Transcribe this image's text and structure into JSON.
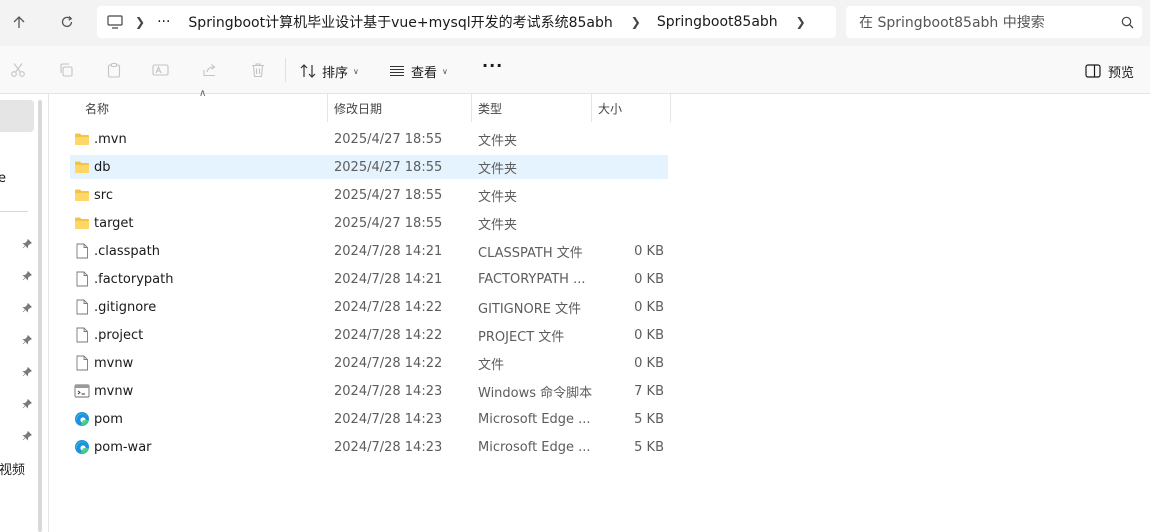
{
  "address_bar": {
    "path_ellipsis": "···",
    "crumbs": [
      "Springboot计算机毕业设计基于vue+mysql开发的考试系统85abh",
      "Springboot85abh"
    ]
  },
  "search": {
    "placeholder": "在 Springboot85abh 中搜索"
  },
  "command_bar": {
    "sort_label": "排序",
    "view_label": "查看",
    "more_label": "···",
    "preview_label": "预览"
  },
  "nav_fragments": {
    "top": "e",
    "bottom": "视频"
  },
  "columns": {
    "name": "名称",
    "date": "修改日期",
    "type": "类型",
    "size": "大小"
  },
  "files": [
    {
      "name": ".mvn",
      "date": "2025/4/27 18:55",
      "type": "文件夹",
      "size": "",
      "icon": "folder-icon"
    },
    {
      "name": "db",
      "date": "2025/4/27 18:55",
      "type": "文件夹",
      "size": "",
      "icon": "folder-icon"
    },
    {
      "name": "src",
      "date": "2025/4/27 18:55",
      "type": "文件夹",
      "size": "",
      "icon": "folder-icon"
    },
    {
      "name": "target",
      "date": "2025/4/27 18:55",
      "type": "文件夹",
      "size": "",
      "icon": "folder-icon"
    },
    {
      "name": ".classpath",
      "date": "2024/7/28 14:21",
      "type": "CLASSPATH 文件",
      "size": "0 KB",
      "icon": "file-icon"
    },
    {
      "name": ".factorypath",
      "date": "2024/7/28 14:21",
      "type": "FACTORYPATH ...",
      "size": "0 KB",
      "icon": "file-icon"
    },
    {
      "name": ".gitignore",
      "date": "2024/7/28 14:22",
      "type": "GITIGNORE 文件",
      "size": "0 KB",
      "icon": "file-icon"
    },
    {
      "name": ".project",
      "date": "2024/7/28 14:22",
      "type": "PROJECT 文件",
      "size": "0 KB",
      "icon": "file-icon"
    },
    {
      "name": "mvnw",
      "date": "2024/7/28 14:22",
      "type": "文件",
      "size": "0 KB",
      "icon": "file-icon"
    },
    {
      "name": "mvnw",
      "date": "2024/7/28 14:23",
      "type": "Windows 命令脚本",
      "size": "7 KB",
      "icon": "script-icon"
    },
    {
      "name": "pom",
      "date": "2024/7/28 14:23",
      "type": "Microsoft Edge ...",
      "size": "5 KB",
      "icon": "edge-icon"
    },
    {
      "name": "pom-war",
      "date": "2024/7/28 14:23",
      "type": "Microsoft Edge ...",
      "size": "5 KB",
      "icon": "edge-icon"
    }
  ]
}
